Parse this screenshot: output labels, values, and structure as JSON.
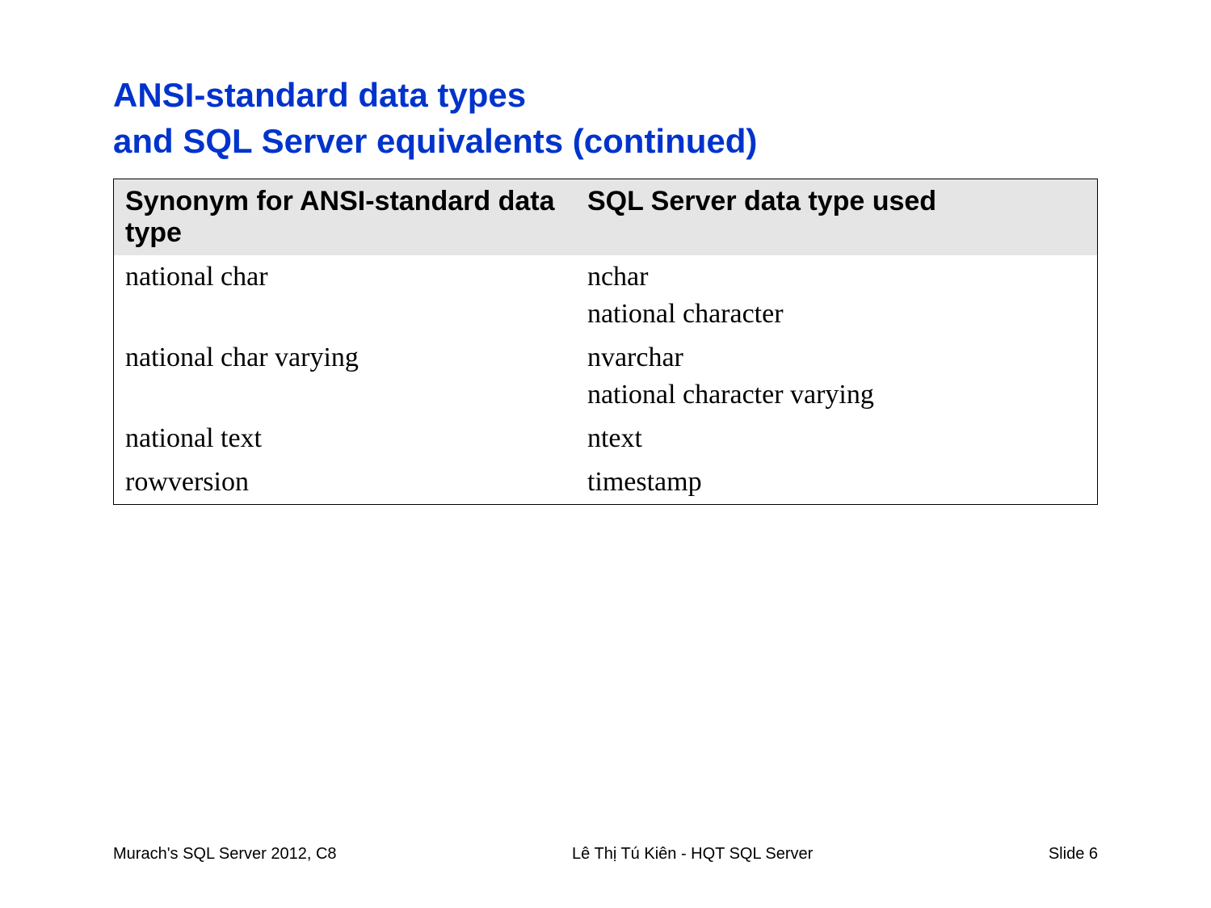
{
  "title_line1": "ANSI-standard data types",
  "title_line2": "and SQL Server equivalents (continued)",
  "table": {
    "headers": {
      "col1": "Synonym for ANSI-standard data type",
      "col2": "SQL Server data type used"
    },
    "rows": [
      {
        "col1": "national char",
        "col2": "nchar\nnational character"
      },
      {
        "col1": "national char varying",
        "col2": "nvarchar\nnational character varying"
      },
      {
        "col1": "national text",
        "col2": "ntext"
      },
      {
        "col1": "rowversion",
        "col2": "timestamp"
      }
    ]
  },
  "footer": {
    "left": "Murach's SQL Server 2012, C8",
    "center": "Lê Thị Tú Kiên - HQT SQL Server",
    "right": "Slide 6"
  }
}
